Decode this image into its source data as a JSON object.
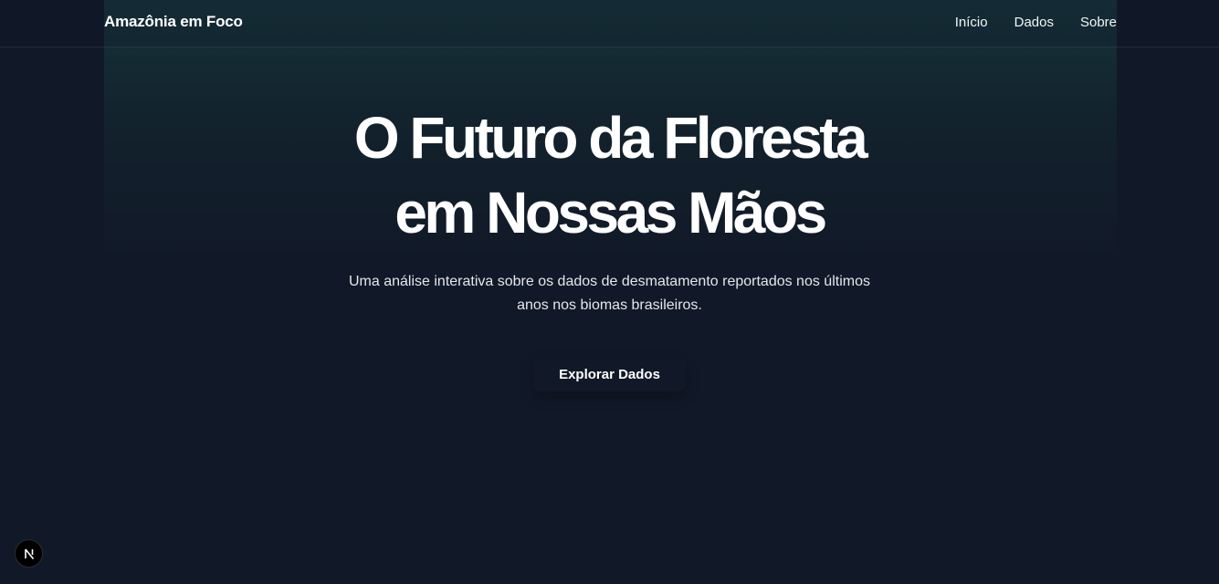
{
  "header": {
    "brand": "Amazônia em Foco",
    "nav": [
      {
        "label": "Início"
      },
      {
        "label": "Dados"
      },
      {
        "label": "Sobre"
      }
    ]
  },
  "hero": {
    "title_line_1": "O Futuro da Floresta",
    "title_line_2": "em Nossas Mãos",
    "subtitle": "Uma análise interativa sobre os dados de desmatamento reportados nos últimos anos nos biomas brasileiros.",
    "cta_label": "Explorar Dados"
  },
  "dev_badge": {
    "icon": "nextjs-logo-icon"
  },
  "colors": {
    "background": "#111827",
    "glow": "#16343a",
    "text": "#ffffff"
  }
}
